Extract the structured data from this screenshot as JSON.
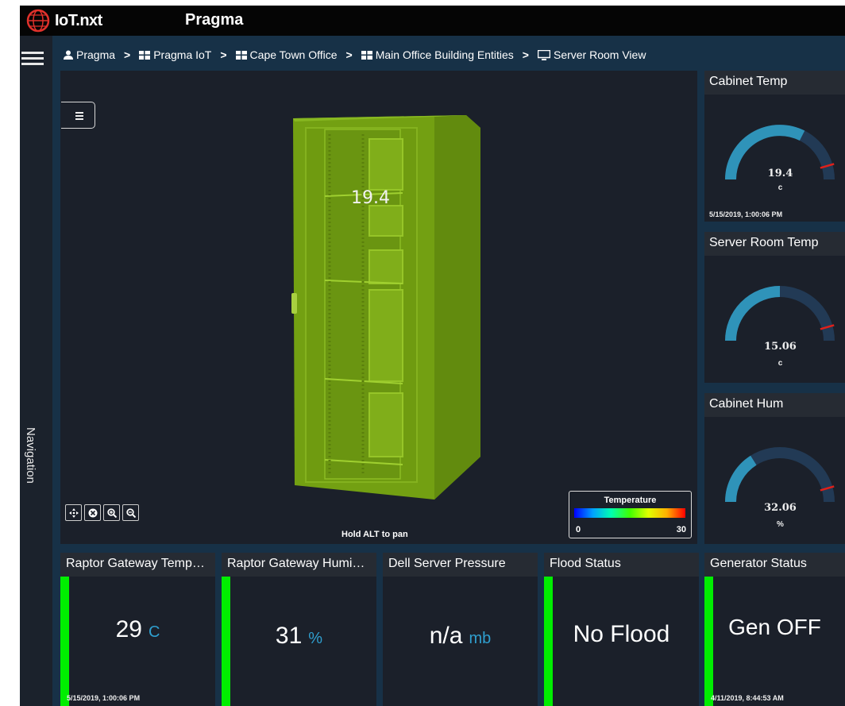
{
  "app": {
    "logo_text": "IoT.nxt",
    "title": "Pragma"
  },
  "nav": {
    "label": "Navigation"
  },
  "breadcrumb": [
    {
      "icon": "user-icon",
      "label": "Pragma"
    },
    {
      "icon": "grid-icon",
      "label": "Pragma IoT"
    },
    {
      "icon": "grid-icon",
      "label": "Cape Town Office"
    },
    {
      "icon": "grid-icon",
      "label": "Main Office Building Entities"
    },
    {
      "icon": "monitor-icon",
      "label": "Server Room View"
    }
  ],
  "viewer": {
    "overlay_value": "19.4",
    "hint": "Hold ALT to pan",
    "legend": {
      "title": "Temperature",
      "min": "0",
      "max": "30"
    },
    "colors": {
      "cabinet_fill": "#7ca816"
    }
  },
  "gauges": [
    {
      "title": "Cabinet Temp",
      "value": "19.4",
      "unit": "c",
      "date": "5/15/2019, 1:00:06 PM",
      "fraction": 0.65
    },
    {
      "title": "Server Room Temp",
      "value": "15.06",
      "unit": "c",
      "date": "",
      "fraction": 0.5
    },
    {
      "title": "Cabinet Hum",
      "value": "32.06",
      "unit": "%",
      "date": "",
      "fraction": 0.32
    }
  ],
  "cards": [
    {
      "title": "Raptor Gateway Tempe...",
      "value": "29",
      "unit": "C",
      "date": "5/15/2019, 1:00:06 PM",
      "status_color": "#00ee00"
    },
    {
      "title": "Raptor Gateway Humidity",
      "value": "31",
      "unit": "%",
      "date": "",
      "status_color": "#00ee00"
    },
    {
      "title": "Dell Server Pressure",
      "value": "n/a",
      "unit": "mb",
      "date": ""
    },
    {
      "title": "Flood Status",
      "value": "No Flood",
      "unit": "",
      "date": "",
      "status_color": "#00ee00"
    },
    {
      "title": "Generator Status",
      "value": "Gen OFF",
      "unit": "",
      "date": "4/11/2019, 8:44:53 AM",
      "status_color": "#00ee00"
    }
  ],
  "colors": {
    "accent": "#2f9fcf",
    "ok": "#00ee00",
    "panel": "#1b202a",
    "frame": "#173147"
  }
}
